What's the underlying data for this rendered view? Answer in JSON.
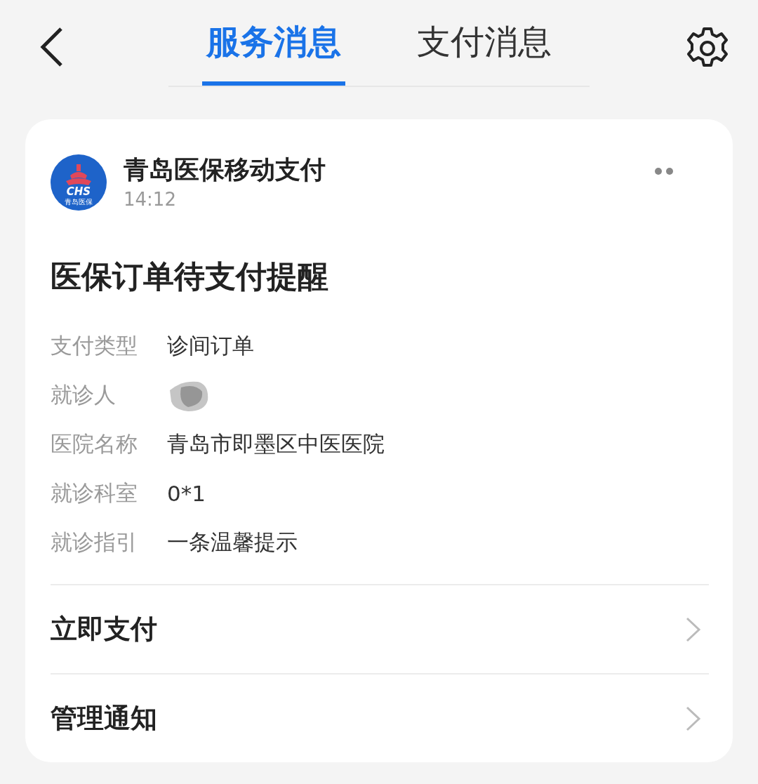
{
  "header": {
    "tabs": [
      {
        "label": "服务消息",
        "selected": true
      },
      {
        "label": "支付消息",
        "selected": false
      }
    ]
  },
  "card": {
    "sender": {
      "name": "青岛医保移动支付",
      "time": "14:12",
      "logo": {
        "mark": "CHS",
        "caption": "青岛医保"
      }
    },
    "title": "医保订单待支付提醒",
    "fields": [
      {
        "kind": "text",
        "label": "支付类型",
        "value": "诊间订单"
      },
      {
        "kind": "redacted",
        "label": "就诊人"
      },
      {
        "kind": "text",
        "label": "医院名称",
        "value": "青岛市即墨区中医医院"
      },
      {
        "kind": "text",
        "label": "就诊科室",
        "value": "0*1"
      },
      {
        "kind": "text",
        "label": "就诊指引",
        "value": "一条温馨提示"
      }
    ],
    "actions": [
      {
        "label": "立即支付"
      },
      {
        "label": "管理通知"
      }
    ]
  }
}
